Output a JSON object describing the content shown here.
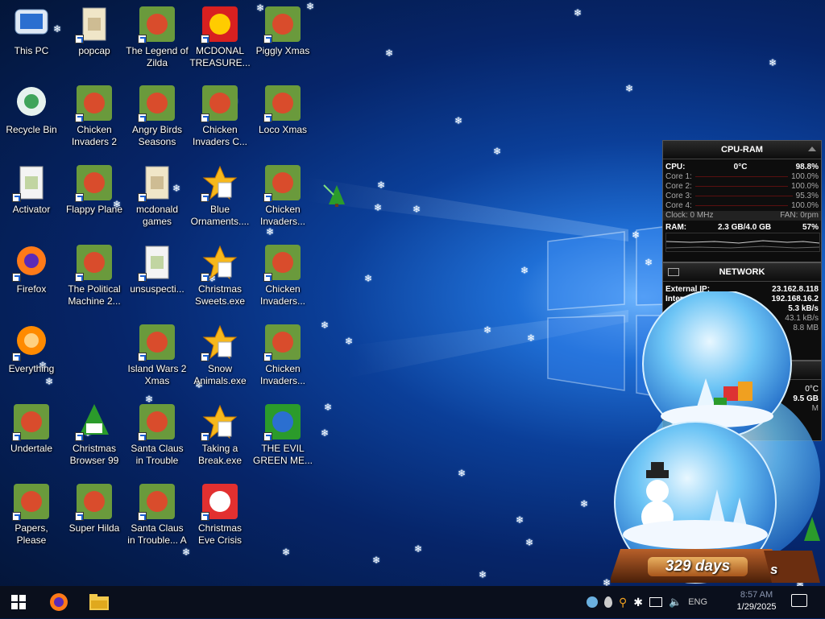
{
  "desktop": {
    "icons": [
      {
        "label": "This PC",
        "icon": "pc-icon"
      },
      {
        "label": "popcap",
        "icon": "folder-icon"
      },
      {
        "label": "The Legend of Zilda",
        "icon": "game-icon"
      },
      {
        "label": "MCDONAL TREASURE...",
        "icon": "mcdonalds-icon"
      },
      {
        "label": "Piggly Xmas",
        "icon": "game-icon"
      },
      {
        "label": "Recycle Bin",
        "icon": "recycle-bin-icon"
      },
      {
        "label": "Chicken Invaders 2",
        "icon": "game-icon"
      },
      {
        "label": "Angry Birds Seasons",
        "icon": "game-icon"
      },
      {
        "label": "Chicken Invaders C...",
        "icon": "game-icon"
      },
      {
        "label": "Loco Xmas",
        "icon": "game-icon"
      },
      {
        "label": "Activator",
        "icon": "file-icon"
      },
      {
        "label": "Flappy Plane",
        "icon": "game-icon"
      },
      {
        "label": "mcdonald games",
        "icon": "folder-icon"
      },
      {
        "label": "Blue Ornaments....",
        "icon": "puzzle-icon"
      },
      {
        "label": "Chicken Invaders...",
        "icon": "game-icon"
      },
      {
        "label": "Firefox",
        "icon": "firefox-icon"
      },
      {
        "label": "The Political Machine 2...",
        "icon": "game-icon"
      },
      {
        "label": "unsuspecti...",
        "icon": "file-icon"
      },
      {
        "label": "Christmas Sweets.exe",
        "icon": "puzzle-icon"
      },
      {
        "label": "Chicken Invaders...",
        "icon": "game-icon"
      },
      {
        "label": "Everything",
        "icon": "search-icon"
      },
      {
        "label": "Island Wars 2 Xmas",
        "icon": "game-icon"
      },
      {
        "label": "Snow Animals.exe",
        "icon": "puzzle-icon"
      },
      {
        "label": "Chicken Invaders...",
        "icon": "game-icon"
      },
      {
        "label": "Undertale",
        "icon": "game-icon"
      },
      {
        "label": "Christmas Browser 99",
        "icon": "tree-icon"
      },
      {
        "label": "Santa Claus in Trouble",
        "icon": "game-icon"
      },
      {
        "label": "Taking a Break.exe",
        "icon": "puzzle-icon"
      },
      {
        "label": "THE EVIL GREEN ME...",
        "icon": "messenger-icon"
      },
      {
        "label": "Papers, Please",
        "icon": "game-icon"
      },
      {
        "label": "Super Hilda",
        "icon": "game-icon"
      },
      {
        "label": "Santa Claus in Trouble... A",
        "icon": "game-icon"
      },
      {
        "label": "Christmas Eve Crisis",
        "icon": "santa-icon"
      }
    ]
  },
  "cpu_ram": {
    "title": "CPU-RAM",
    "cpu_label": "CPU:",
    "cpu_temp": "0°C",
    "cpu_value": "98.8%",
    "cores": [
      {
        "label": "Core 1:",
        "value": "100.0%"
      },
      {
        "label": "Core 2:",
        "value": "100.0%"
      },
      {
        "label": "Core 3:",
        "value": "95.3%"
      },
      {
        "label": "Core 4:",
        "value": "100.0%"
      }
    ],
    "clock_label": "Clock: 0 MHz",
    "fan_label": "FAN: 0rpm",
    "ram_label": "RAM:",
    "ram_value": "2.3 GB/4.0 GB",
    "ram_percent": "57%"
  },
  "network": {
    "title": "NETWORK",
    "external_ip_label": "External IP:",
    "external_ip": "23.162.8.118",
    "internal_ip_label": "Interna",
    "internal_ip": "192.168.16.2",
    "down_rate": "5.3 kB/s",
    "up_rate": "43.1 kB/s",
    "total": "8.8 MB"
  },
  "drive": {
    "temp": "0°C",
    "size": "9.5 GB",
    "label": "M"
  },
  "snowglobe": {
    "counter": "329 days",
    "counter_back": "s"
  },
  "taskbar": {
    "tray_lang": "ENG",
    "tray_time": "8:57 AM",
    "tray_date": "1/29/2025"
  },
  "colors": {
    "accent": "#1f6fd6",
    "taskbar": "#0a0f1c",
    "gadget_bg": "#0d0d0d"
  }
}
